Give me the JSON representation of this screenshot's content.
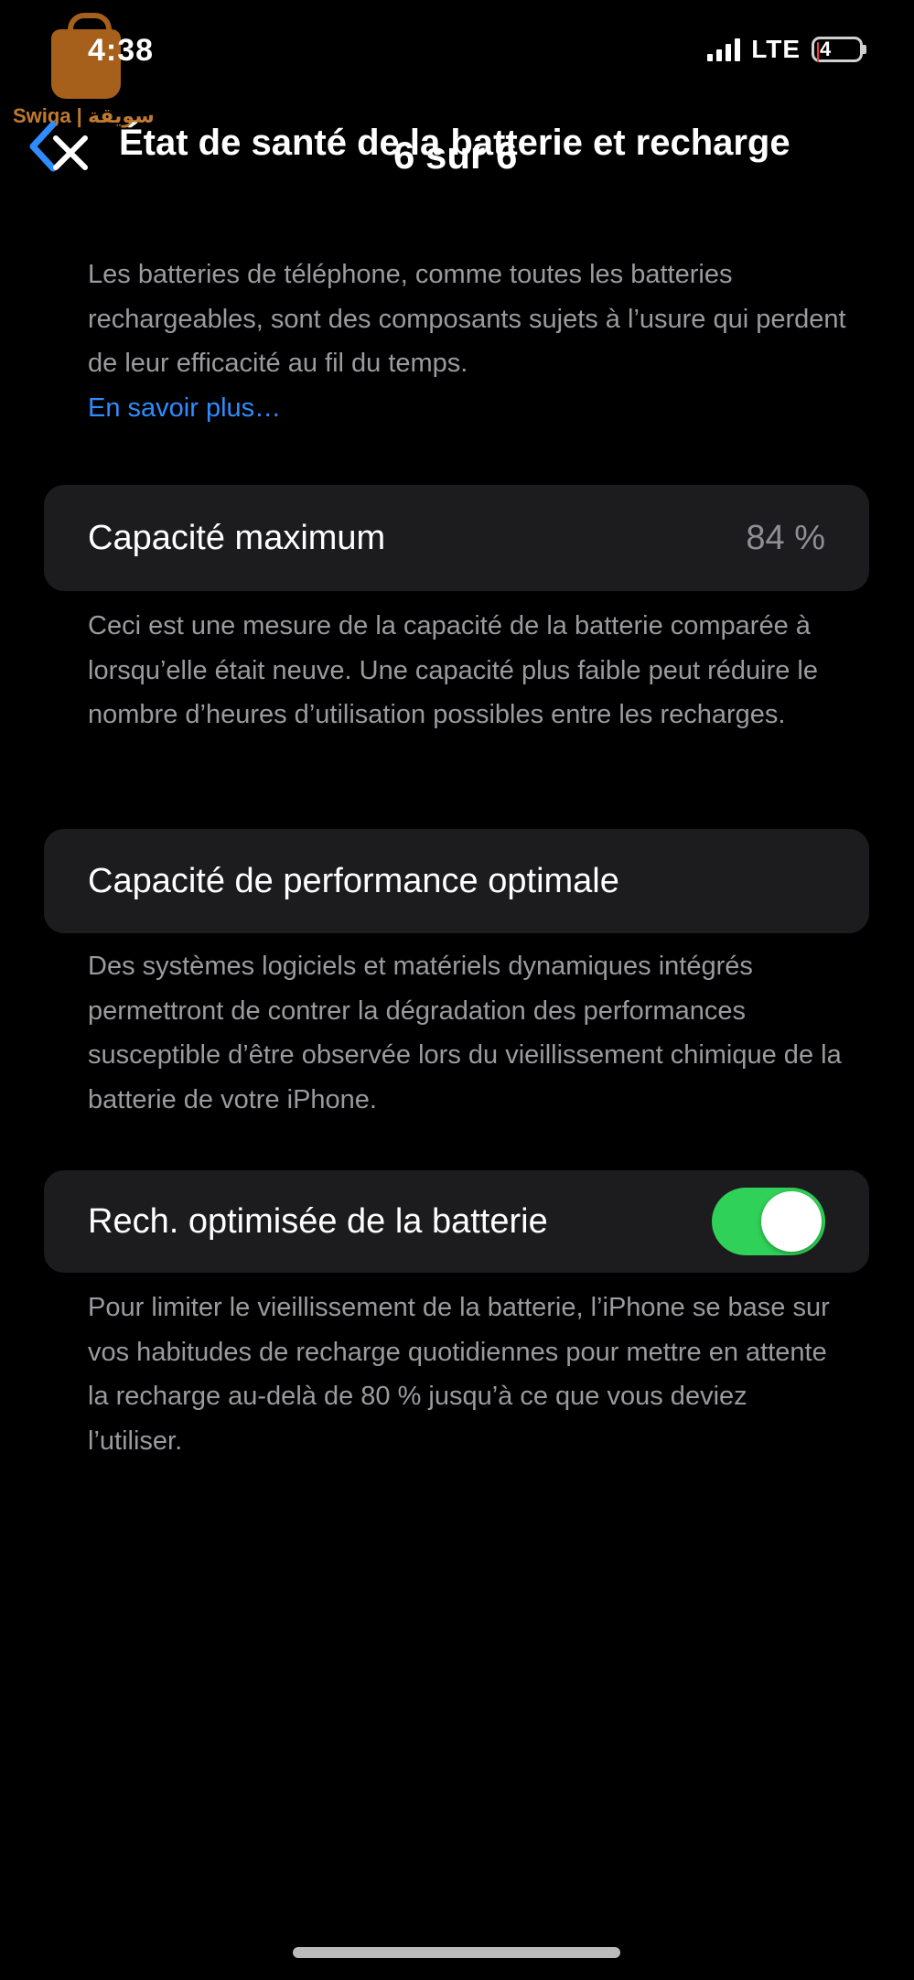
{
  "status": {
    "time": "4:38",
    "network": "LTE",
    "battery_level": "4",
    "battery_fraction": 0.04,
    "battery_color": "#ff3b30"
  },
  "watermark": {
    "text": "Swiga | سويقة",
    "icon": "shopping-bag-icon",
    "color": "#b86b1f"
  },
  "header": {
    "title": "État de santé de la batterie et recharge",
    "page_indicator": "6 sur 6",
    "back_icon": "chevron-left-icon",
    "close_icon": "close-icon",
    "accent_color": "#2f8cff"
  },
  "intro": {
    "text": "Les batteries de téléphone, comme toutes les batteries rechargeables, sont des composants sujets à l’usure qui perdent de leur efficacité au fil du temps.",
    "link_label": "En savoir plus…"
  },
  "max_capacity": {
    "label": "Capacité maximum",
    "value": "84 %",
    "description": "Ceci est une mesure de la capacité de la batterie comparée à lorsqu’elle était neuve. Une capacité plus faible peut réduire le nombre d’heures d’utilisation possibles entre les recharges."
  },
  "performance": {
    "label": "Capacité de performance optimale",
    "description": "Des systèmes logiciels et matériels dynamiques intégrés permettront de contrer la dégradation des performances susceptible d’être observée lors du vieillissement chimique de la batterie de votre iPhone."
  },
  "optimized_charging": {
    "label": "Rech. optimisée de la batterie",
    "enabled": true,
    "toggle_color": "#30d158",
    "description": "Pour limiter le vieillissement de la batterie, l’iPhone se base sur vos habitudes de recharge quotidiennes pour mettre en attente la recharge au-delà de 80 % jusqu’à ce que vous deviez l’utiliser."
  }
}
